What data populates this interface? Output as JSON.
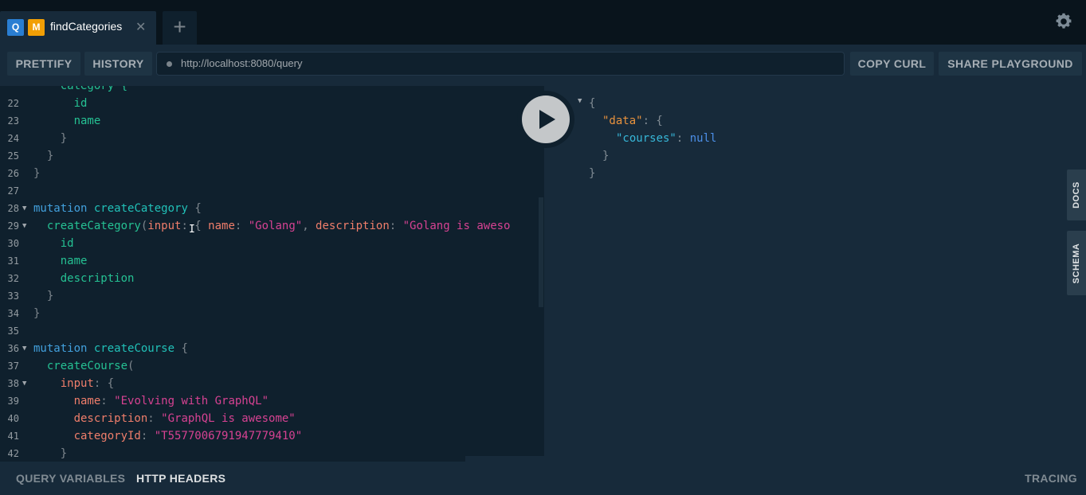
{
  "tabs": [
    {
      "badges": [
        "Q",
        "M"
      ],
      "title": "findCategories",
      "close": "✕"
    }
  ],
  "new_tab_label": "+",
  "toolbar": {
    "prettify": "PRETTIFY",
    "history": "HISTORY",
    "endpoint_url": "http://localhost:8080/query",
    "copy_curl": "COPY CURL",
    "share": "SHARE PLAYGROUND"
  },
  "editor": {
    "lines": [
      {
        "n": "",
        "tokens": [
          {
            "c": "fld",
            "t": "    category {"
          }
        ]
      },
      {
        "n": "22",
        "tokens": [
          {
            "c": "fld",
            "t": "      id"
          }
        ]
      },
      {
        "n": "23",
        "tokens": [
          {
            "c": "fld",
            "t": "      name"
          }
        ]
      },
      {
        "n": "24",
        "tokens": [
          {
            "c": "p",
            "t": "    }"
          }
        ]
      },
      {
        "n": "25",
        "tokens": [
          {
            "c": "p",
            "t": "  }"
          }
        ]
      },
      {
        "n": "26",
        "tokens": [
          {
            "c": "p",
            "t": "}"
          }
        ]
      },
      {
        "n": "27",
        "tokens": []
      },
      {
        "n": "28",
        "fold": true,
        "tokens": [
          {
            "c": "kw",
            "t": "mutation"
          },
          {
            "c": "",
            "t": " "
          },
          {
            "c": "def",
            "t": "createCategory"
          },
          {
            "c": "p",
            "t": " {"
          }
        ]
      },
      {
        "n": "29",
        "fold": true,
        "tokens": [
          {
            "c": "fld",
            "t": "  createCategory"
          },
          {
            "c": "p",
            "t": "("
          },
          {
            "c": "arg",
            "t": "input"
          },
          {
            "c": "p",
            "t": ": { "
          },
          {
            "c": "arg",
            "t": "name"
          },
          {
            "c": "p",
            "t": ": "
          },
          {
            "c": "str",
            "t": "\"Golang\""
          },
          {
            "c": "p",
            "t": ", "
          },
          {
            "c": "arg",
            "t": "description"
          },
          {
            "c": "p",
            "t": ": "
          },
          {
            "c": "str",
            "t": "\"Golang is aweso"
          }
        ]
      },
      {
        "n": "30",
        "tokens": [
          {
            "c": "fld",
            "t": "    id"
          }
        ]
      },
      {
        "n": "31",
        "tokens": [
          {
            "c": "fld",
            "t": "    name"
          }
        ]
      },
      {
        "n": "32",
        "tokens": [
          {
            "c": "fld",
            "t": "    description"
          }
        ]
      },
      {
        "n": "33",
        "tokens": [
          {
            "c": "p",
            "t": "  }"
          }
        ]
      },
      {
        "n": "34",
        "tokens": [
          {
            "c": "p",
            "t": "}"
          }
        ]
      },
      {
        "n": "35",
        "tokens": []
      },
      {
        "n": "36",
        "fold": true,
        "tokens": [
          {
            "c": "kw",
            "t": "mutation"
          },
          {
            "c": "",
            "t": " "
          },
          {
            "c": "def",
            "t": "createCourse"
          },
          {
            "c": "p",
            "t": " {"
          }
        ]
      },
      {
        "n": "37",
        "tokens": [
          {
            "c": "fld",
            "t": "  createCourse"
          },
          {
            "c": "p",
            "t": "("
          }
        ]
      },
      {
        "n": "38",
        "fold": true,
        "tokens": [
          {
            "c": "arg",
            "t": "    input"
          },
          {
            "c": "p",
            "t": ": {"
          }
        ]
      },
      {
        "n": "39",
        "tokens": [
          {
            "c": "arg",
            "t": "      name"
          },
          {
            "c": "p",
            "t": ": "
          },
          {
            "c": "str",
            "t": "\"Evolving with GraphQL\""
          }
        ]
      },
      {
        "n": "40",
        "tokens": [
          {
            "c": "arg",
            "t": "      description"
          },
          {
            "c": "p",
            "t": ": "
          },
          {
            "c": "str",
            "t": "\"GraphQL is awesome\""
          }
        ]
      },
      {
        "n": "41",
        "tokens": [
          {
            "c": "arg",
            "t": "      categoryId"
          },
          {
            "c": "p",
            "t": ": "
          },
          {
            "c": "str",
            "t": "\"T5577006791947779410\""
          }
        ]
      },
      {
        "n": "42",
        "tokens": [
          {
            "c": "p",
            "t": "    }"
          }
        ]
      }
    ]
  },
  "result": {
    "lines": [
      {
        "indent": 0,
        "tokens": [
          {
            "c": "p",
            "t": "{"
          }
        ]
      },
      {
        "indent": 1,
        "tokens": [
          {
            "c": "jkey",
            "t": "\"data\""
          },
          {
            "c": "p",
            "t": ": {"
          }
        ]
      },
      {
        "indent": 2,
        "tokens": [
          {
            "c": "jkey2",
            "t": "\"courses\""
          },
          {
            "c": "p",
            "t": ": "
          },
          {
            "c": "jnull",
            "t": "null"
          }
        ]
      },
      {
        "indent": 1,
        "tokens": [
          {
            "c": "p",
            "t": "}"
          }
        ]
      },
      {
        "indent": 0,
        "tokens": [
          {
            "c": "p",
            "t": "}"
          }
        ]
      }
    ]
  },
  "side_tabs": {
    "docs": "DOCS",
    "schema": "SCHEMA"
  },
  "bottom": {
    "query_variables": "QUERY VARIABLES",
    "http_headers": "HTTP HEADERS",
    "tracing": "TRACING"
  },
  "colors": {
    "keyword": "#42a0dd",
    "definition": "#21c1b8",
    "field": "#25c193",
    "argument": "#f07e6b",
    "string": "#d64292",
    "json_key": "#e8923d",
    "json_null": "#4c8fe8"
  },
  "icons": {
    "settings": "gear-icon",
    "run": "play-icon",
    "fold": "triangle-down-icon"
  }
}
